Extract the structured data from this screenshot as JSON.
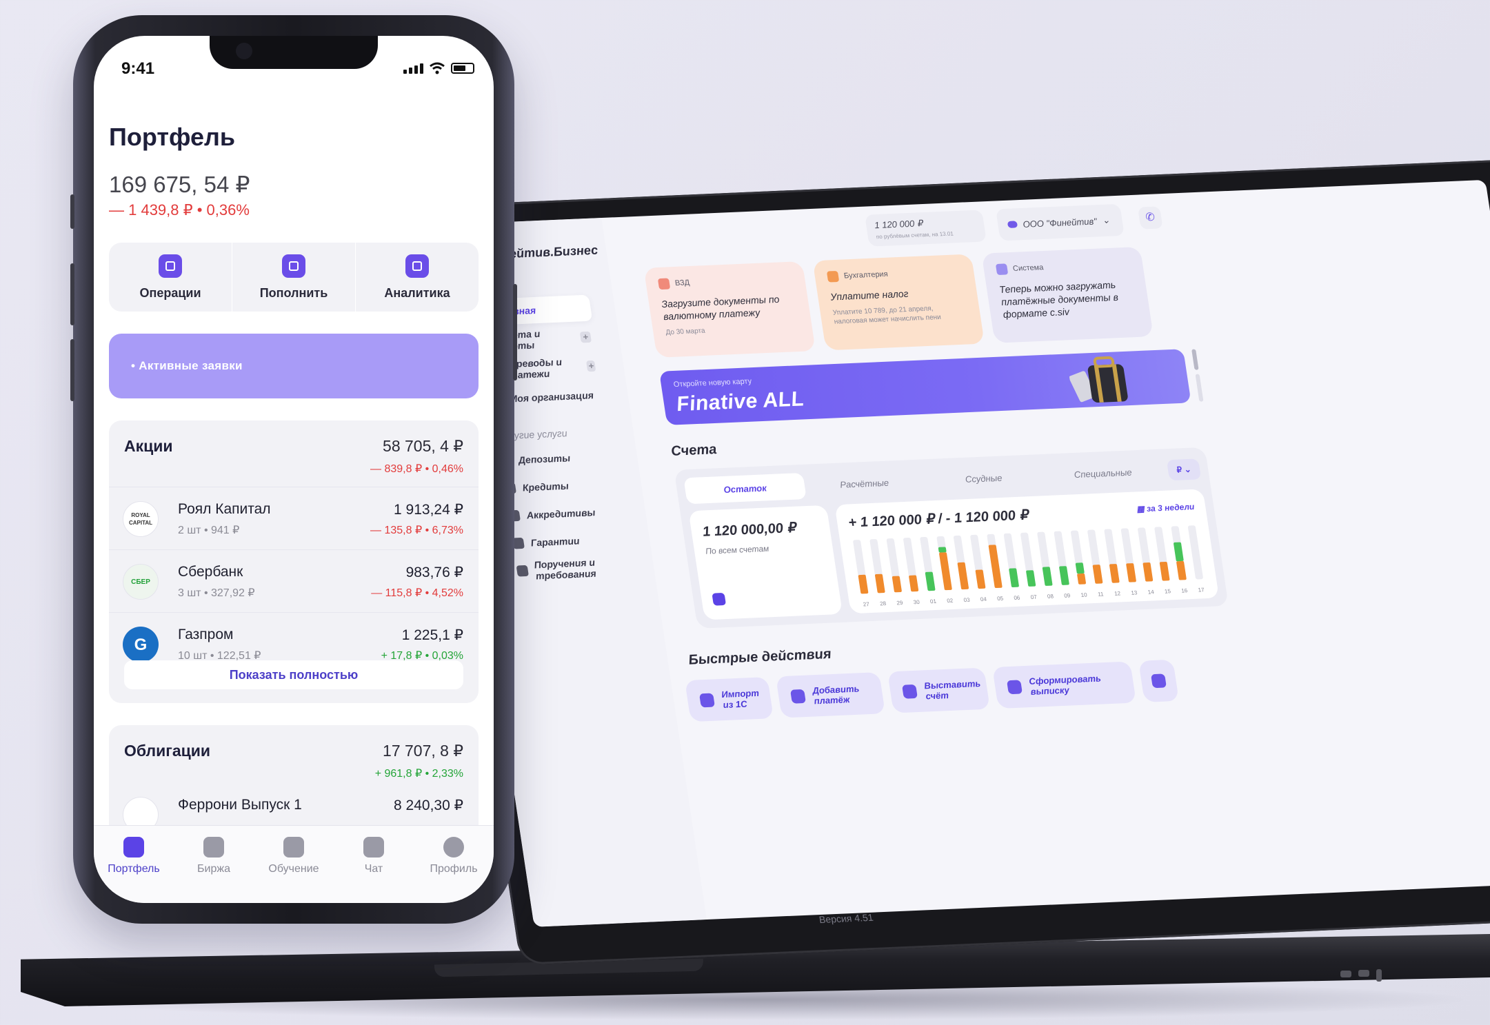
{
  "desktop": {
    "brand": "Финейтив.Бизнес",
    "topbar": {
      "balance": "1 120 000 ₽",
      "balance_sub": "по рублёвым счетам, на 13.01",
      "org": "ООО \"Финейтив\"",
      "org_chevron": "⌄",
      "phone_icon": "phone-icon"
    },
    "nav": [
      {
        "label": "Главная",
        "icon": "home-icon",
        "plus": ""
      },
      {
        "label": "Счета и карты",
        "icon": "card-icon",
        "plus": "+"
      },
      {
        "label": "Переводы и платежи",
        "icon": "transfer-icon",
        "plus": "+"
      },
      {
        "label": "Моя организация",
        "icon": "building-icon",
        "plus": ""
      }
    ],
    "other_services_label": "Другие услуги",
    "other_nav": [
      {
        "label": "Депозиты",
        "icon": "deposit-icon"
      },
      {
        "label": "Кредиты",
        "icon": "credit-icon"
      },
      {
        "label": "Аккредитивы",
        "icon": "accreditive-icon"
      },
      {
        "label": "Гарантии",
        "icon": "guarantee-icon"
      },
      {
        "label": "Поручения и требования",
        "icon": "orders-icon"
      }
    ],
    "notices": [
      {
        "tag": "ВЗД",
        "title": "Загрузите документы по валютному платежу",
        "sub": "До 30 марта",
        "color": "#fbe7e4",
        "icon_color": "#f08a7a"
      },
      {
        "tag": "Бухгалтерия",
        "title": "Уплатите налог",
        "sub": "Уплатите 10 789, до 21 апреля, налоговая может начислить пени",
        "color": "#fce1cc",
        "icon_color": "#f39a52"
      },
      {
        "tag": "Система",
        "title": "Теперь можно загружать платёжные документы в формате c.siv",
        "sub": "",
        "color": "#e8e6f5",
        "icon_color": "#9a8ef0"
      }
    ],
    "banner": {
      "small": "Откройте новую карту",
      "big": "Finative ALL"
    },
    "accounts_title": "Счета",
    "tabs": [
      "Остаток",
      "Расчётные",
      "Ссудные",
      "Специальные"
    ],
    "currency_button": "₽ ⌄",
    "balance_value": "1 120 000,00 ₽",
    "balance_sub": "По всем счетам",
    "chart_head": "+ 1 120 000 ₽  /  - 1 120 000 ₽",
    "chart_period": "за 3 недели",
    "quick_title": "Быстрые действия",
    "quick_actions": [
      "Импорт из 1С",
      "Добавить платёж",
      "Выставить счёт",
      "Сформировать выписку"
    ],
    "version": "Версия 4.51"
  },
  "chart_data": {
    "type": "bar",
    "title": "",
    "xlabel": "",
    "ylabel": "",
    "categories": [
      "27",
      "28",
      "29",
      "30",
      "01",
      "02",
      "03",
      "04",
      "05",
      "06",
      "07",
      "08",
      "09",
      "10",
      "11",
      "12",
      "13",
      "14",
      "15",
      "16",
      "17"
    ],
    "series": [
      {
        "name": "",
        "color": "#f08a2c",
        "values": [
          0.35,
          0.35,
          0.3,
          0.3,
          0,
          0.7,
          0.5,
          0.35,
          0.8,
          0,
          0,
          0,
          0,
          0.2,
          0.35,
          0.35,
          0.35,
          0.35,
          0.35,
          0.35,
          0
        ]
      },
      {
        "name": "",
        "color": "#47c45a",
        "values": [
          0,
          0,
          0,
          0,
          0.35,
          0.1,
          0,
          0,
          0,
          0.35,
          0.3,
          0.35,
          0.35,
          0.2,
          0,
          0,
          0,
          0,
          0,
          0.35,
          0
        ]
      }
    ],
    "ylim": [
      0,
      1
    ],
    "grid": false
  },
  "phone": {
    "time": "9:41",
    "title": "Портфель",
    "total": "169 675, 54 ₽",
    "change": "— 1 439,8 ₽ • 0,36%",
    "actions": [
      {
        "label": "Операции",
        "icon": "operations-icon"
      },
      {
        "label": "Пополнить",
        "icon": "deposit-doc-icon"
      },
      {
        "label": "Аналитика",
        "icon": "analytics-icon"
      }
    ],
    "requests": "•  Активные заявки",
    "stocks": {
      "title": "Акции",
      "value": "58 705, 4 ₽",
      "change": "— 839,8 ₽ • 0,46%",
      "items": [
        {
          "logo": "ROYAL CAPITAL",
          "name": "Роял Капитал",
          "meta": "2 шт • 941 ₽",
          "value": "1 913,24 ₽",
          "change": "— 135,8 ₽ • 6,73%",
          "dir": "neg"
        },
        {
          "logo": "СБЕР",
          "name": "Сбербанк",
          "meta": "3 шт • 327,92 ₽",
          "value": "983,76 ₽",
          "change": "— 115,8 ₽ • 4,52%",
          "dir": "neg"
        },
        {
          "logo": "G",
          "name": "Газпром",
          "meta": "10 шт • 122,51 ₽",
          "value": "1 225,1 ₽",
          "change": "+ 17,8 ₽ • 0,03%",
          "dir": "pos"
        }
      ],
      "show_all": "Показать полностью"
    },
    "bonds": {
      "title": "Облигации",
      "value": "17 707, 8 ₽",
      "change": "+ 961,8 ₽ • 2,33%",
      "items": [
        {
          "logo": "",
          "name": "Феррони Выпуск 1",
          "value": "8 240,30 ₽"
        }
      ]
    },
    "tabbar": [
      {
        "label": "Портфель",
        "icon": "briefcase-icon"
      },
      {
        "label": "Биржа",
        "icon": "chart-icon"
      },
      {
        "label": "Обучение",
        "icon": "layers-icon"
      },
      {
        "label": "Чат",
        "icon": "chat-icon"
      },
      {
        "label": "Профиль",
        "icon": "profile-icon"
      }
    ]
  }
}
